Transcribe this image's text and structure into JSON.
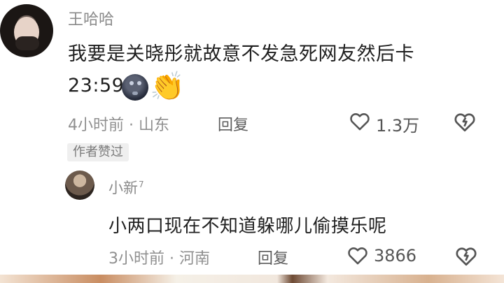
{
  "comment": {
    "username": "王哈哈",
    "text_line1": "我要是关晓彤就故意不发急死网友然后卡",
    "text_line2": "23:59",
    "meta": "4小时前 · 山东",
    "reply_label": "回复",
    "like_count": "1.3万",
    "badge": "作者赞过",
    "emojis": [
      "new-moon-face-icon",
      "clapping-hands-icon"
    ]
  },
  "reply": {
    "username": "小新",
    "username_sup": "7",
    "text": "小两口现在不知道躲哪儿偷摸乐呢",
    "meta": "3小时前 · 河南",
    "reply_label": "回复",
    "like_count": "3866"
  },
  "colors": {
    "username": "#8a8a8a",
    "text": "#1f1f1f",
    "meta": "#8f8f8f",
    "badge_bg": "#efefef"
  }
}
